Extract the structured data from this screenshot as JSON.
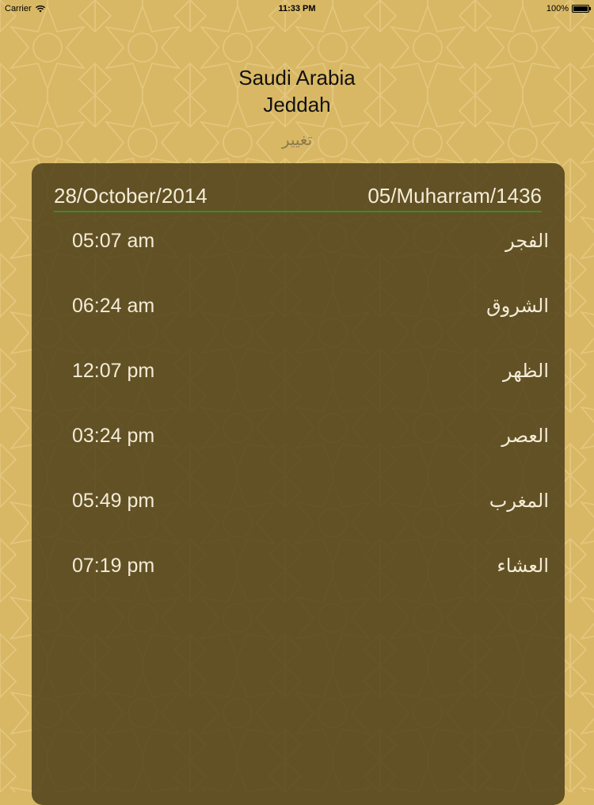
{
  "status_bar": {
    "carrier": "Carrier",
    "time": "11:33 PM",
    "battery": "100%",
    "battery_level": 1.0
  },
  "location": {
    "country": "Saudi Arabia",
    "city": "Jeddah",
    "change_label": "تغيير"
  },
  "dates": {
    "gregorian": "28/October/2014",
    "hijri": "05/Muharram/1436"
  },
  "prayers": [
    {
      "name": "الفجر",
      "time": "05:07 am"
    },
    {
      "name": "الشروق",
      "time": "06:24 am"
    },
    {
      "name": "الظهر",
      "time": "12:07 pm"
    },
    {
      "name": "العصر",
      "time": "03:24 pm"
    },
    {
      "name": "المغرب",
      "time": "05:49 pm"
    },
    {
      "name": "العشاء",
      "time": "07:19 pm"
    }
  ],
  "colors": {
    "background": "#d9b865",
    "pattern_line": "#e6cc86",
    "panel": "#483a16",
    "divider": "#3a8a2e",
    "panel_text": "#f3ecd8",
    "change_text": "#8c7a4e"
  },
  "icons": {
    "wifi": "wifi-icon",
    "battery": "battery-icon"
  }
}
